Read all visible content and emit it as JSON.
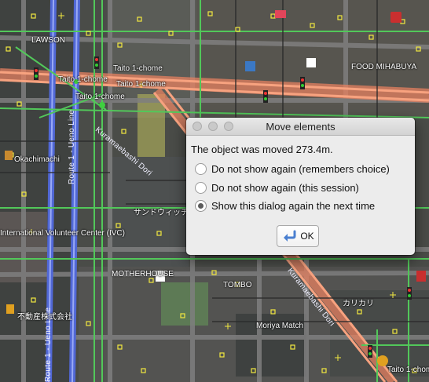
{
  "dialog": {
    "title": "Move elements",
    "message": "The object was moved 273.4m.",
    "options": [
      {
        "label": "Do not show again (remembers choice)",
        "selected": false
      },
      {
        "label": "Do not show again (this session)",
        "selected": false
      },
      {
        "label": "Show this dialog again the next time",
        "selected": true
      }
    ],
    "ok_label": "OK",
    "ok_icon": "return-arrow-icon"
  },
  "map": {
    "labels": {
      "lawson": "LAWSON",
      "taito1a": "Taito 1-chome",
      "taito1b": "Taito 1-chome",
      "taito1c": "Taito 1-chome",
      "taito1d": "Taito 1-chome",
      "kuramaebashi": "Kuramaebashi Dori",
      "kuramaebashi2": "Kuramaebashi Dori",
      "route1": "Route 1 - Ueno Line",
      "route2": "Route 1 - Ueno Line",
      "intl_center": "International Volunteer Center (IVC)",
      "okachimachi": "Okachimachi",
      "food_mihabuya": "FOOD MIHABUYA",
      "motherhouse": "MOTHERHOUSE",
      "tombo": "TOMBO",
      "moriya": "Moriya Match",
      "sand": "サンドウィッチ",
      "karikari": "カリカリ",
      "fudosan": "不動産株式会社",
      "taito1_bottom": "Taito 1-chome"
    }
  },
  "colors": {
    "major_road": "#f28a67",
    "highway": "#6f86e0",
    "footway": "#67d36d",
    "node": "#f2e840",
    "dialog_bg": "#ececec"
  }
}
